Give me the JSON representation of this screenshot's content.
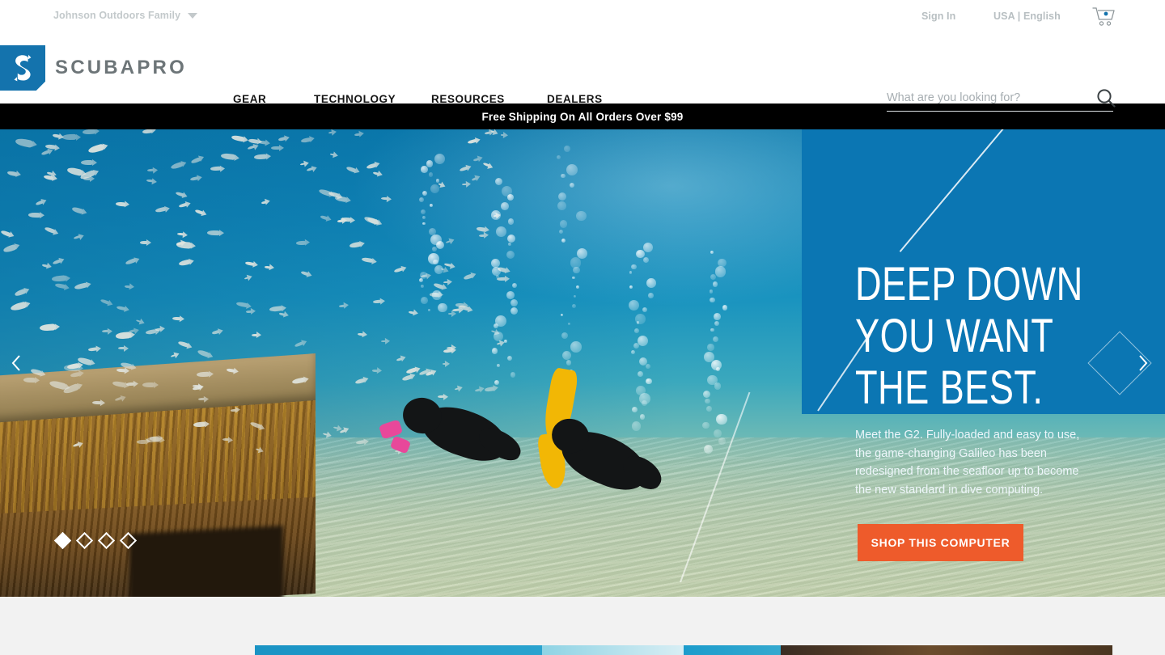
{
  "utility": {
    "family_label": "Johnson Outdoors Family",
    "family_caret": "chevron-down-icon",
    "sign_in": "Sign In",
    "locale": "USA | English",
    "cart_icon": "shopping-cart-icon"
  },
  "header": {
    "logo_mark": "scubapro-s-logo",
    "logo_word": "SCUBAPRO",
    "nav": [
      {
        "label": "GEAR"
      },
      {
        "label": "TECHNOLOGY"
      },
      {
        "label": "RESOURCES"
      },
      {
        "label": "DEALERS"
      }
    ],
    "search": {
      "placeholder": "What are you looking for?",
      "value": "",
      "icon": "search-icon"
    }
  },
  "promo": {
    "text": "Free Shipping On All Orders Over $99"
  },
  "hero": {
    "headline": "DEEP DOWN\nYOU WANT\nTHE BEST.",
    "body": "Meet the G2. Fully-loaded and easy to use, the game-changing Galileo has been redesigned from the seafloor up to become the new standard in dive computing.",
    "cta_label": "SHOP THIS COMPUTER",
    "prev_icon": "chevron-left-icon",
    "next_icon": "chevron-right-icon",
    "slides": [
      {
        "index": 1,
        "active": true
      },
      {
        "index": 2,
        "active": false
      },
      {
        "index": 3,
        "active": false
      },
      {
        "index": 4,
        "active": false
      }
    ],
    "image_alt": "Two scuba divers swimming over a shipwreck surrounded by a school of fish"
  },
  "colors": {
    "brand_blue": "#0b76b3",
    "logo_blue": "#1473ad",
    "cta_orange": "#ee5b2b",
    "promo_black": "#000000",
    "logo_gray": "#6d7578",
    "util_gray": "#b8bfc2",
    "below_gray": "#f2f2f2"
  }
}
